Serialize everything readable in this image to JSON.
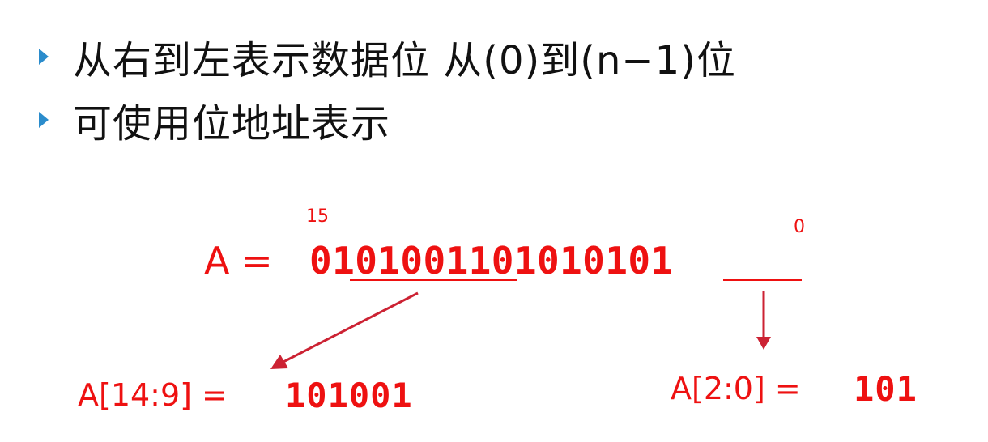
{
  "bullets": [
    {
      "text": "从右到左表示数据位 从(0)到(n−1)位"
    },
    {
      "text": "可使用位地址表示"
    }
  ],
  "diagram": {
    "register_label": "A =",
    "bits": "0101001101010101",
    "msb_index": "15",
    "lsb_index": "0",
    "slices": [
      {
        "label": "A[14:9] =",
        "value": "101001"
      },
      {
        "label": "A[2:0] =",
        "value": "101"
      }
    ]
  },
  "colors": {
    "accent": "#ee1111",
    "bullet": "#2b8ccc",
    "arrow": "#cc2233",
    "text": "#111111"
  }
}
